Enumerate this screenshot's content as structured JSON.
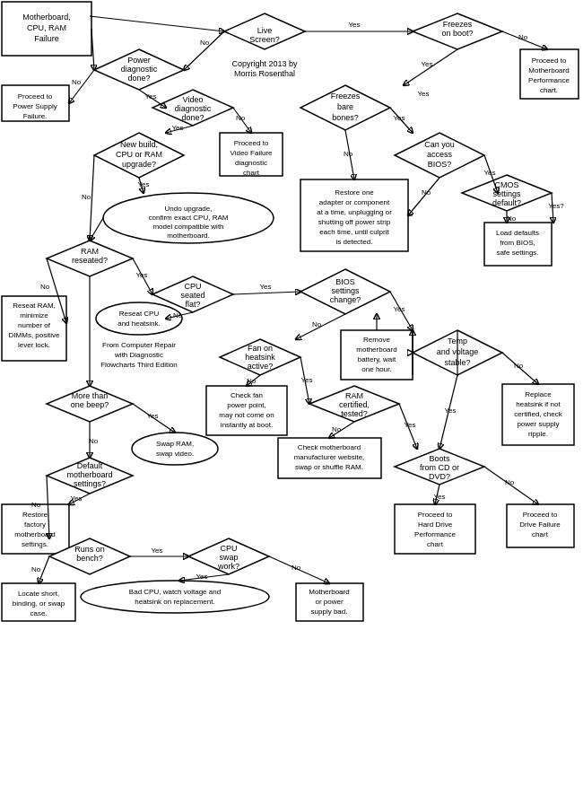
{
  "title": "Motherboard, CPU, RAM Failure",
  "copyright": "Copyright 2013 by Morris Rosenthal",
  "source": "From Computer Repair with Diagnostic Flowcharts Third Edition",
  "nodes": {
    "title": "Motherboard,\nCPU, RAM\nFailure",
    "live_screen": "Live\nScreen?",
    "power_diag": "Power\ndiagnostic\ndone?",
    "video_diag": "Video\ndiagnostic\ndone?",
    "freezes_boot": "Freezes\non boot?",
    "freezes_bare": "Freezes\nbare\nbones?",
    "can_access_bios": "Can you\naccess\nBIOS?",
    "new_build": "New build,\nCPU or RAM\nupgrade?",
    "ram_reseated": "RAM\nreseated?",
    "cpu_seated": "CPU\nseated\nflat?",
    "bios_settings": "BIOS\nsettings\nchange?",
    "fan_heatsink": "Fan on\nheatsink\nactive?",
    "more_beep": "More than\none beep?",
    "default_mb": "Default\nmotherboard\nsettings?",
    "runs_bench": "Runs on\nbench?",
    "cpu_swap": "CPU\nswap\nwork?",
    "ram_certified": "RAM\ncertified,\ntested?",
    "temp_voltage": "Temp\nand voltage\nstable?",
    "cmos_default": "CMOS\nsettings\ndefault?",
    "boots_cd": "Boots\nfrom CD or\nDVD?",
    "proceed_power": "Proceed to\nPower Supply\nFailure.",
    "proceed_video": "Proceed to\nVideo Failure\ndiagnostic\nchart",
    "proceed_mb_perf": "Proceed to\nMotherboard\nPerformance\nchart.",
    "undo_upgrade": "Undo upgrade,\nconfirm  exact CPU, RAM\nmodel compatible with\nmotherboard.",
    "restore_adapter": "Restore one\nadapter or component\nat a time, unplugging or\nshutting off power strip\neach time, until culprit\nis detected.",
    "reseat_cpu": "Reseat CPU\nand heatsink.",
    "reseat_ram": "Reseat RAM,\nminimize\nnumber of\nDIMMs, positive\nlever lock.",
    "load_defaults": "Load defaults\nfrom BIOS,\nsafe settings.",
    "remove_battery": "Remove\nmotherboard\nbattery, wait\none hour.",
    "check_fan": "Check fan\npower point,\nmay not come on\ninstantly at boot.",
    "swap_ram_video": "Swap RAM,\nswap video.",
    "restore_factory": "Restore\nfactory\nmotherboard\nsettings.",
    "check_mb_web": "Check motherboard\nmanufacturer website,\nswap or shuffle RAM.",
    "replace_heatsink": "Replace\nheatsink if not\ncertified, check\npower supply\nripple.",
    "locate_short": "Locate short,\nbinding, or swap\ncase.",
    "bad_cpu": "Bad CPU, watch voltage and\nheatsink on replacement.",
    "motherboard_bad": "Motherboard\nor power\nsupply bad.",
    "proceed_hdd": "Proceed to\nHard Drive\nPerformance\nchart",
    "proceed_drive": "Proceed to\nDrive Failure\nchart"
  }
}
